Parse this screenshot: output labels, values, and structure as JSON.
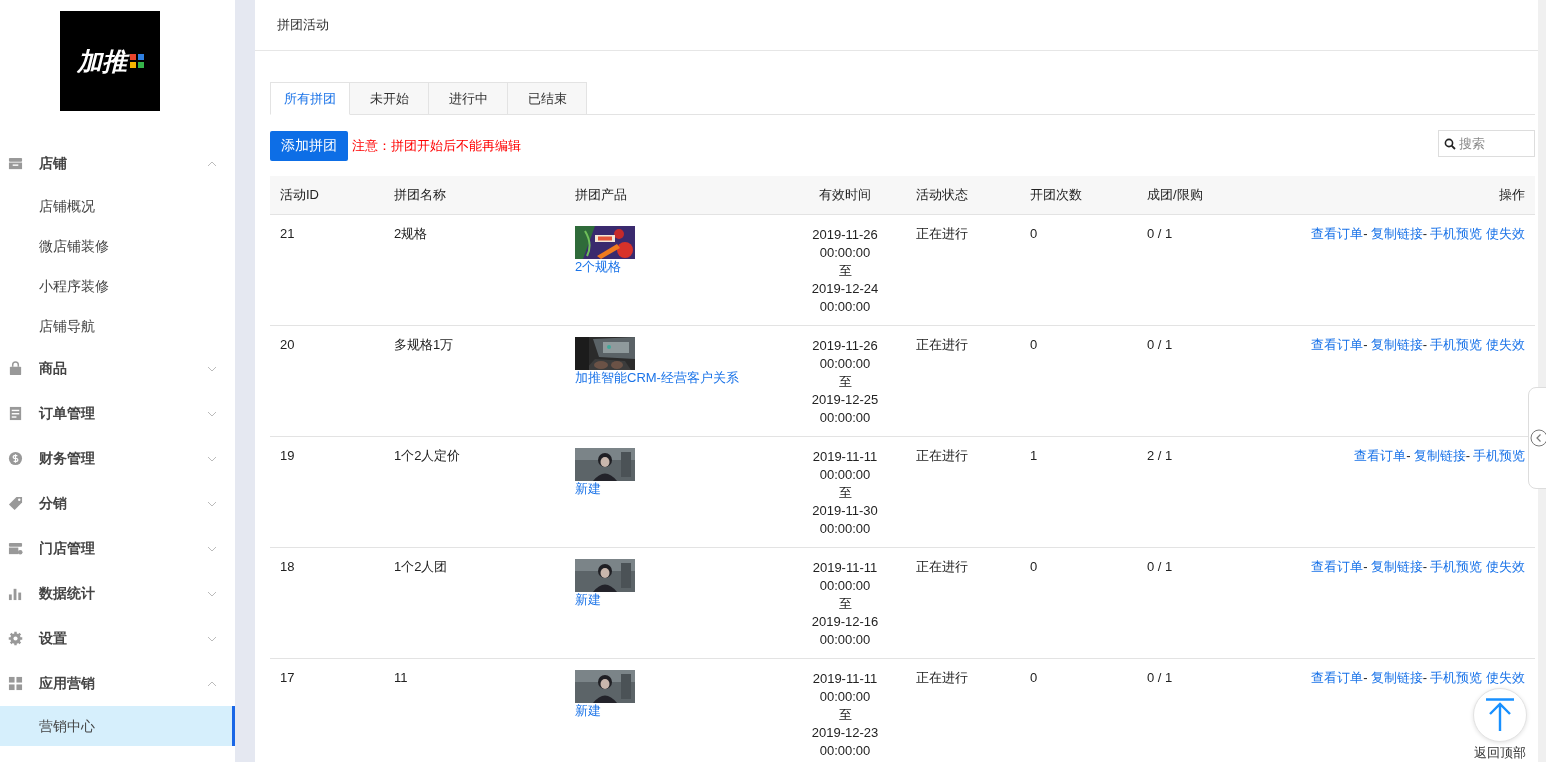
{
  "logo": {
    "text": "加推"
  },
  "sidebar": {
    "items": [
      {
        "label": "店铺",
        "expanded": true,
        "children": [
          {
            "label": "店铺概况",
            "selected": false
          },
          {
            "label": "微店铺装修",
            "selected": false
          },
          {
            "label": "小程序装修",
            "selected": false
          },
          {
            "label": "店铺导航",
            "selected": false
          }
        ]
      },
      {
        "label": "商品",
        "expanded": false
      },
      {
        "label": "订单管理",
        "expanded": false
      },
      {
        "label": "财务管理",
        "expanded": false
      },
      {
        "label": "分销",
        "expanded": false
      },
      {
        "label": "门店管理",
        "expanded": false
      },
      {
        "label": "数据统计",
        "expanded": false
      },
      {
        "label": "设置",
        "expanded": false
      },
      {
        "label": "应用营销",
        "expanded": true,
        "children": [
          {
            "label": "营销中心",
            "selected": true
          }
        ]
      }
    ]
  },
  "page_title": "拼团活动",
  "tabs": [
    {
      "label": "所有拼团",
      "selected": true
    },
    {
      "label": "未开始",
      "selected": false
    },
    {
      "label": "进行中",
      "selected": false
    },
    {
      "label": "已结束",
      "selected": false
    }
  ],
  "add_button": "添加拼团",
  "notice": "注意：拼团开始后不能再编辑",
  "search": {
    "placeholder": "搜索"
  },
  "table": {
    "columns": [
      "活动ID",
      "拼团名称",
      "拼团产品",
      "有效时间",
      "活动状态",
      "开团次数",
      "成团/限购",
      "操作"
    ],
    "rows": [
      {
        "id": "21",
        "name": "2规格",
        "product": {
          "kind": "picture",
          "label": "2个规格"
        },
        "start": "2019-11-26 00:00:00",
        "to": "至",
        "end": "2019-12-24 00:00:00",
        "status": "正在进行",
        "opens": "0",
        "ratio": "0 / 1",
        "actions": [
          {
            "kind": "link",
            "text": "查看订单"
          },
          {
            "kind": "sep",
            "text": "-"
          },
          {
            "kind": "link",
            "text": "复制链接"
          },
          {
            "kind": "sep",
            "text": "-"
          },
          {
            "kind": "link",
            "text": "手机预览"
          },
          {
            "kind": "link",
            "text": "使失效"
          }
        ]
      },
      {
        "id": "20",
        "name": "多规格1万",
        "product": {
          "kind": "picture",
          "label": "加推智能CRM-经营客户关系"
        },
        "start": "2019-11-26 00:00:00",
        "to": "至",
        "end": "2019-12-25 00:00:00",
        "status": "正在进行",
        "opens": "0",
        "ratio": "0 / 1",
        "actions": [
          {
            "kind": "link",
            "text": "查看订单"
          },
          {
            "kind": "sep",
            "text": "-"
          },
          {
            "kind": "link",
            "text": "复制链接"
          },
          {
            "kind": "sep",
            "text": "-"
          },
          {
            "kind": "link",
            "text": "手机预览"
          },
          {
            "kind": "link",
            "text": "使失效"
          }
        ]
      },
      {
        "id": "19",
        "name": "1个2人定价",
        "product": {
          "kind": "picture",
          "label": "新建"
        },
        "start": "2019-11-11 00:00:00",
        "to": "至",
        "end": "2019-11-30 00:00:00",
        "status": "正在进行",
        "opens": "1",
        "ratio": "2 / 1",
        "actions": [
          {
            "kind": "link",
            "text": "查看订单"
          },
          {
            "kind": "sep",
            "text": "-"
          },
          {
            "kind": "link",
            "text": "复制链接"
          },
          {
            "kind": "sep",
            "text": "-"
          },
          {
            "kind": "link",
            "text": "手机预览"
          }
        ]
      },
      {
        "id": "18",
        "name": "1个2人团",
        "product": {
          "kind": "picture",
          "label": "新建"
        },
        "start": "2019-11-11 00:00:00",
        "to": "至",
        "end": "2019-12-16 00:00:00",
        "status": "正在进行",
        "opens": "0",
        "ratio": "0 / 1",
        "actions": [
          {
            "kind": "link",
            "text": "查看订单"
          },
          {
            "kind": "sep",
            "text": "-"
          },
          {
            "kind": "link",
            "text": "复制链接"
          },
          {
            "kind": "sep",
            "text": "-"
          },
          {
            "kind": "link",
            "text": "手机预览"
          },
          {
            "kind": "link",
            "text": "使失效"
          }
        ]
      },
      {
        "id": "17",
        "name": "11",
        "product": {
          "kind": "picture",
          "label": "新建"
        },
        "start": "2019-11-11 00:00:00",
        "to": "至",
        "end": "2019-12-23 00:00:00",
        "status": "正在进行",
        "opens": "0",
        "ratio": "0 / 1",
        "actions": [
          {
            "kind": "link",
            "text": "查看订单"
          },
          {
            "kind": "sep",
            "text": "-"
          },
          {
            "kind": "link",
            "text": "复制链接"
          },
          {
            "kind": "sep",
            "text": "-"
          },
          {
            "kind": "link",
            "text": "手机预览"
          },
          {
            "kind": "link",
            "text": "使失效"
          }
        ]
      }
    ]
  },
  "back_to_top": "返回顶部"
}
